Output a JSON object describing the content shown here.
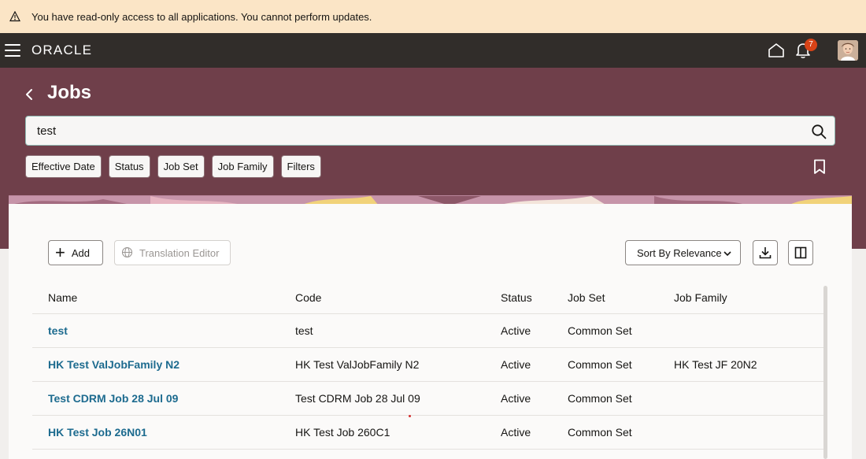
{
  "banner": {
    "message": "You have read-only access to all applications. You cannot perform updates."
  },
  "topbar": {
    "logo": "ORACLE",
    "notification_count": "7"
  },
  "header": {
    "title": "Jobs",
    "search": {
      "value": "test",
      "placeholder": ""
    },
    "chips": [
      "Effective Date",
      "Status",
      "Job Set",
      "Job Family",
      "Filters"
    ]
  },
  "toolbar": {
    "add_label": "Add",
    "translation_label": "Translation Editor",
    "sort_label": "Sort By Relevance"
  },
  "table": {
    "columns": [
      "Name",
      "Code",
      "Status",
      "Job Set",
      "Job Family"
    ],
    "rows": [
      [
        "test",
        "test",
        "Active",
        "Common Set",
        ""
      ],
      [
        "HK Test ValJobFamily N2",
        "HK Test ValJobFamily N2",
        "Active",
        "Common Set",
        "HK Test JF 20N2"
      ],
      [
        "Test CDRM Job 28 Jul 09",
        "Test CDRM Job 28 Jul 09",
        "Active",
        "Common Set",
        ""
      ],
      [
        "HK Test Job 26N01",
        "HK Test Job 260C1",
        "Active",
        "Common Set",
        ""
      ]
    ]
  },
  "colors": {
    "header_bg": "#6f3f4a",
    "topbar_bg": "#312d2a",
    "banner_bg": "#fbe5c6",
    "link": "#1d6b8f",
    "badge": "#d84317"
  }
}
